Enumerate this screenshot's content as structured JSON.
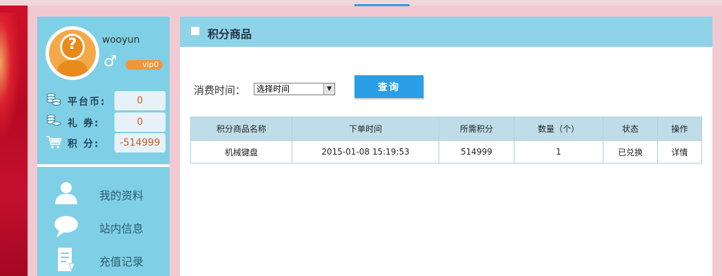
{
  "user": {
    "username": "wooyun",
    "gender_symbol": "♂",
    "vip_level": "vip0"
  },
  "stats": [
    {
      "label": "平台币:",
      "value": "0",
      "icon": "coins-icon"
    },
    {
      "label": "礼  券:",
      "value": "0",
      "icon": "coupon-icon"
    },
    {
      "label": "积  分:",
      "value": "-514999",
      "icon": "cart-icon"
    }
  ],
  "menu": [
    {
      "label": "我的资料",
      "icon": "user-icon"
    },
    {
      "label": "站内信息",
      "icon": "message-icon"
    },
    {
      "label": "充值记录",
      "icon": "record-icon"
    }
  ],
  "panel": {
    "title": "积分商品"
  },
  "filter": {
    "label": "消费时间：",
    "select_value": "选择时间",
    "query_button": "查询"
  },
  "table": {
    "headers": [
      "积分商品名称",
      "下单时间",
      "所需积分",
      "数量（个）",
      "状态",
      "操作"
    ],
    "rows": [
      {
        "name": "机械键盘",
        "time": "2015-01-08 15:19:53",
        "points": "514999",
        "quantity": "1",
        "status": "已兑换",
        "action": "详情"
      }
    ]
  },
  "colors": {
    "accent": "#2a9ee6",
    "sidebar": "#7fd0e6",
    "header": "#8fd3e8",
    "vip_badge": "#f0963a"
  }
}
